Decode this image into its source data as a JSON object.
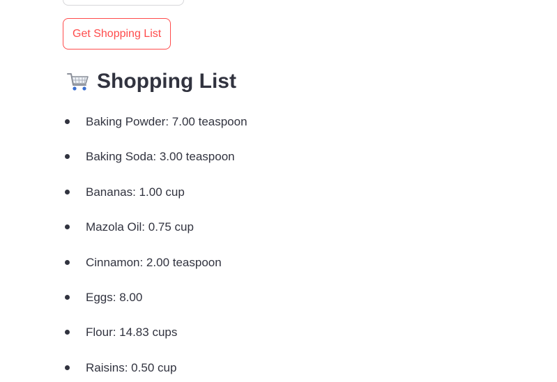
{
  "actions": {
    "get_list_label": "Get Shopping List"
  },
  "section": {
    "icon": "shopping-cart-icon",
    "title": "Shopping List"
  },
  "shopping_list": [
    "Baking Powder: 7.00 teaspoon",
    "Baking Soda: 3.00 teaspoon",
    "Bananas: 1.00 cup",
    "Mazola Oil: 0.75 cup",
    "Cinnamon: 2.00 teaspoon",
    "Eggs: 8.00",
    "Flour: 14.83 cups",
    "Raisins: 0.50 cup"
  ],
  "colors": {
    "accent": "#ff4b4b",
    "text": "#31333f"
  }
}
